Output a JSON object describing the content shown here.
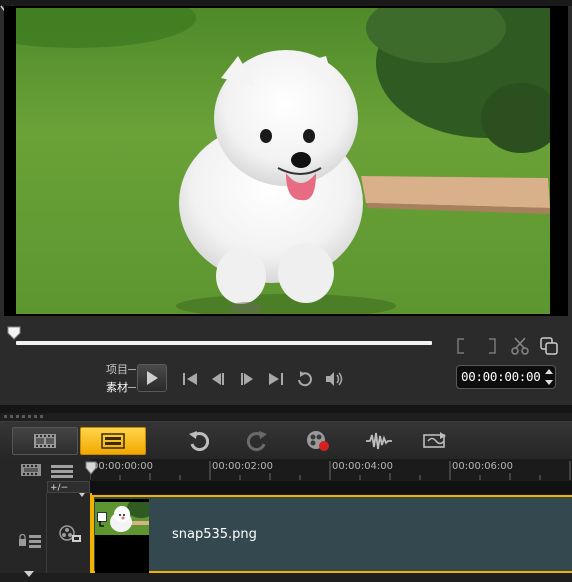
{
  "preview": {
    "image_subject": "white fluffy puppy running on grass"
  },
  "playback": {
    "mode_project_label": "项目",
    "mode_clip_label": "素材",
    "timecode": "00:00:00:00"
  },
  "toolbar": {
    "icons": [
      "film-strip-icon",
      "timeline-icon",
      "undo-icon",
      "redo-icon",
      "record-capture-icon",
      "audio-wave-icon",
      "auto-music-icon"
    ]
  },
  "timeline": {
    "ruler_ticks": [
      "00:00:00:00",
      "00:00:02:00",
      "00:00:04:00",
      "00:00:06:00"
    ],
    "zoom_label": "+/−",
    "clip": {
      "name": "snap535.png"
    }
  },
  "colors": {
    "accent": "#f2b300",
    "clip_bg": "#33494f",
    "panel_bg": "#2b2b2b"
  }
}
